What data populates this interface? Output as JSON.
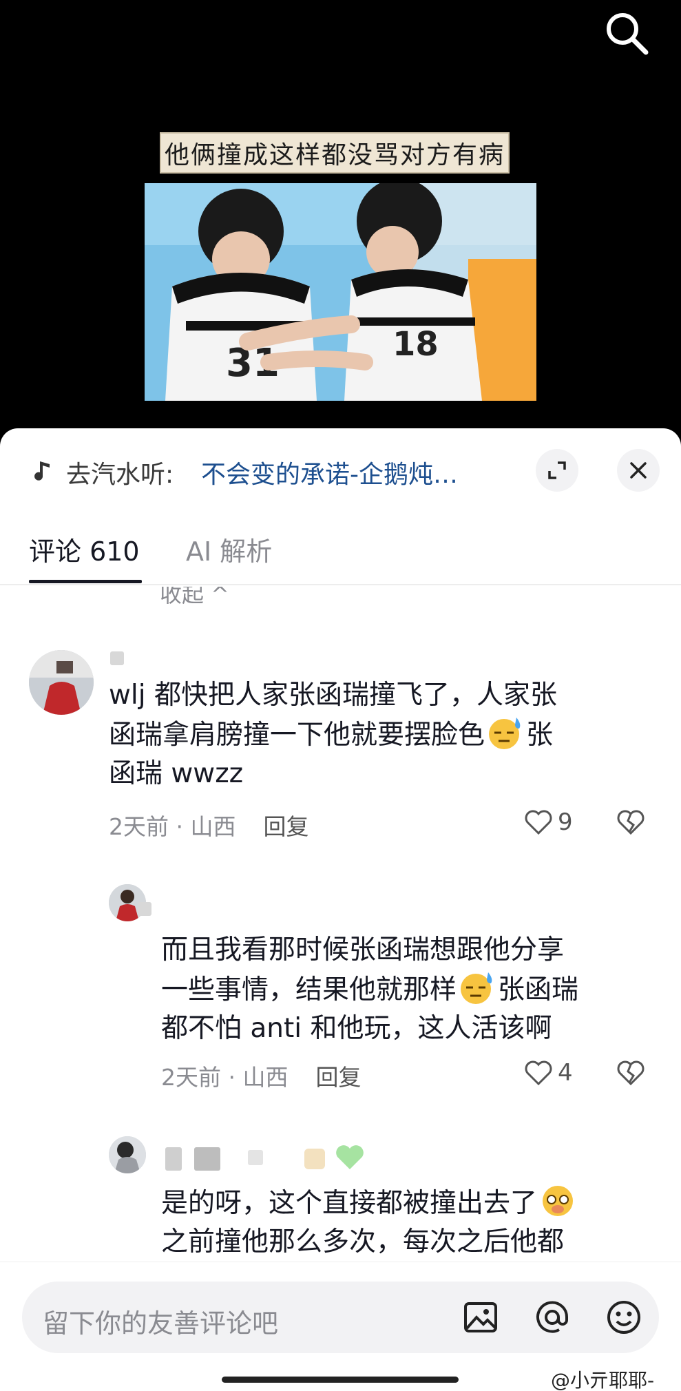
{
  "video": {
    "caption": "他俩撞成这样都没骂对方有病",
    "search_icon": "search-icon"
  },
  "music": {
    "prefix": "去汽水听:",
    "title": "不会变的承诺-企鹅炖…",
    "icon": "music-note-icon"
  },
  "tabs": {
    "comments": "评论 610",
    "ai": "AI 解析"
  },
  "collapse_label": "收起 ^",
  "comments": [
    {
      "lines": [
        "wlj 都快把人家张函瑞撞飞了，人家张",
        "函瑞拿肩膀撞一下他就要摆脸色",
        "张",
        "函瑞 wwzz"
      ],
      "time": "2天前",
      "location": "山西",
      "reply": "回复",
      "likes": "9"
    },
    {
      "lines": [
        "而且我看那时候张函瑞想跟他分享",
        "一些事情，结果他就那样",
        "张函瑞",
        "都不怕 anti 和他玩，这人活该啊"
      ],
      "time": "2天前",
      "location": "山西",
      "reply": "回复",
      "likes": "4"
    },
    {
      "lines": [
        "是的呀，这个直接都被撞出去了",
        "之前撞他那么多次，每次之后他都"
      ]
    }
  ],
  "input": {
    "placeholder": "留下你的友善评论吧"
  },
  "watermark": "@小亓耶耶-",
  "colors": {
    "link": "#1d4f8f",
    "muted": "#8a8b91",
    "text": "#161823"
  }
}
